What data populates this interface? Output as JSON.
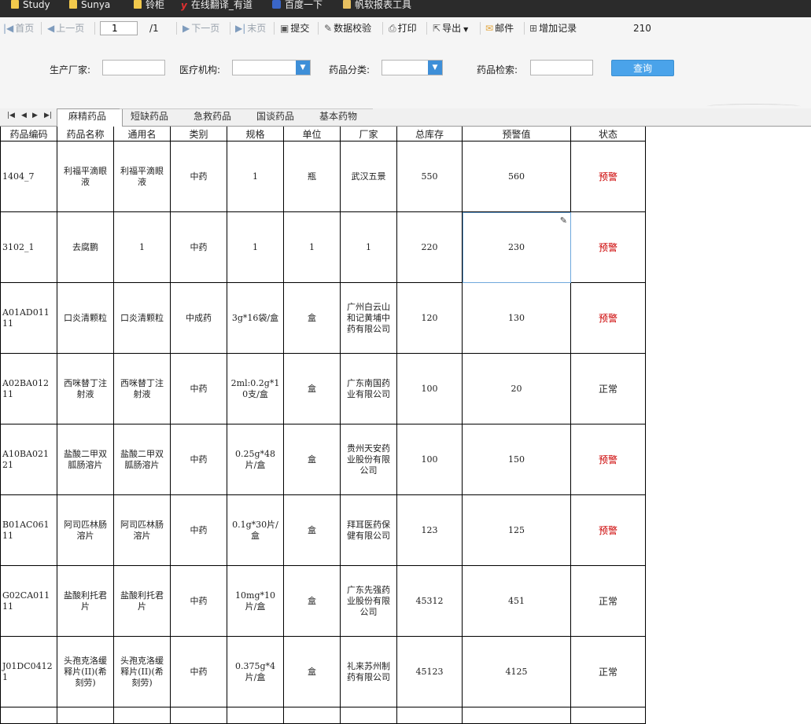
{
  "bookmarks": [
    {
      "label": "Study",
      "icon": "folder-icon"
    },
    {
      "label": "Sunya",
      "icon": "folder-icon"
    },
    {
      "label": "铃柜",
      "icon": "folder-icon"
    },
    {
      "label": "在线翻译_有道",
      "icon": "youdao-icon"
    },
    {
      "label": "百度一下",
      "icon": "baidu-icon"
    },
    {
      "label": "帆软报表工具",
      "icon": "page-icon"
    }
  ],
  "toolbar": {
    "first": "首页",
    "prev": "上一页",
    "page_value": "1",
    "page_total": "/1",
    "next": "下一页",
    "last": "末页",
    "submit": "提交",
    "verify": "数据校验",
    "print": "打印",
    "export": "导出",
    "mail": "邮件",
    "add_record": "增加记录",
    "record_count": "210"
  },
  "filter": {
    "manufacturer_label": "生产厂家:",
    "manufacturer_value": "",
    "institution_label": "医疗机构:",
    "institution_value": "",
    "category_label": "药品分类:",
    "category_value": "",
    "search_label": "药品检索:",
    "search_value": "",
    "query_button": "查询"
  },
  "sheet_tabs": [
    "麻精药品",
    "短缺药品",
    "急救药品",
    "国谈药品",
    "基本药物"
  ],
  "active_tab": 0,
  "table": {
    "headers": [
      "药品编码",
      "药品名称",
      "通用名",
      "类别",
      "规格",
      "单位",
      "厂家",
      "总库存",
      "预警值",
      "状态"
    ],
    "rows": [
      {
        "code": "1404_7",
        "name": "利福平滴眼液",
        "generic": "利福平滴眼液",
        "type": "中药",
        "spec": "1",
        "unit": "瓶",
        "maker": "武汉五景",
        "stock": "550",
        "threshold": "560",
        "status": "预警"
      },
      {
        "code": "3102_1",
        "name": "去腐鹏",
        "generic": "1",
        "type": "中药",
        "spec": "1",
        "unit": "1",
        "maker": "1",
        "stock": "220",
        "threshold": "230",
        "status": "预警"
      },
      {
        "code": "A01AD01111",
        "name": "口炎清颗粒",
        "generic": "口炎清颗粒",
        "type": "中成药",
        "spec": "3g*16袋/盒",
        "unit": "盒",
        "maker": "广州白云山和记黄埔中药有限公司",
        "stock": "120",
        "threshold": "130",
        "status": "预警"
      },
      {
        "code": "A02BA01211",
        "name": "西咪替丁注射液",
        "generic": "西咪替丁注射液",
        "type": "中药",
        "spec": "2ml:0.2g*10支/盒",
        "unit": "盒",
        "maker": "广东南国药业有限公司",
        "stock": "100",
        "threshold": "20",
        "status": "正常"
      },
      {
        "code": "A10BA02121",
        "name": "盐酸二甲双胍肠溶片",
        "generic": "盐酸二甲双胍肠溶片",
        "type": "中药",
        "spec": "0.25g*48片/盒",
        "unit": "盒",
        "maker": "贵州天安药业股份有限公司",
        "stock": "100",
        "threshold": "150",
        "status": "预警"
      },
      {
        "code": "B01AC06111",
        "name": "阿司匹林肠溶片",
        "generic": "阿司匹林肠溶片",
        "type": "中药",
        "spec": "0.1g*30片/盒",
        "unit": "盒",
        "maker": "拜耳医药保健有限公司",
        "stock": "123",
        "threshold": "125",
        "status": "预警"
      },
      {
        "code": "G02CA01111",
        "name": "盐酸利托君片",
        "generic": "盐酸利托君片",
        "type": "中药",
        "spec": "10mg*10片/盒",
        "unit": "盒",
        "maker": "广东先强药业股份有限公司",
        "stock": "45312",
        "threshold": "451",
        "status": "正常"
      },
      {
        "code": "J01DC04121",
        "name": "头孢克洛缓释片(II)(希刻劳)",
        "generic": "头孢克洛缓释片(II)(希刻劳)",
        "type": "中药",
        "spec": "0.375g*4片/盒",
        "unit": "盒",
        "maker": "礼来苏州制药有限公司",
        "stock": "45123",
        "threshold": "4125",
        "status": "正常"
      }
    ]
  },
  "colors": {
    "warn": "#cc0000",
    "query_button": "#4aa3ea",
    "dropdown_arrow": "#3e8fd8"
  }
}
